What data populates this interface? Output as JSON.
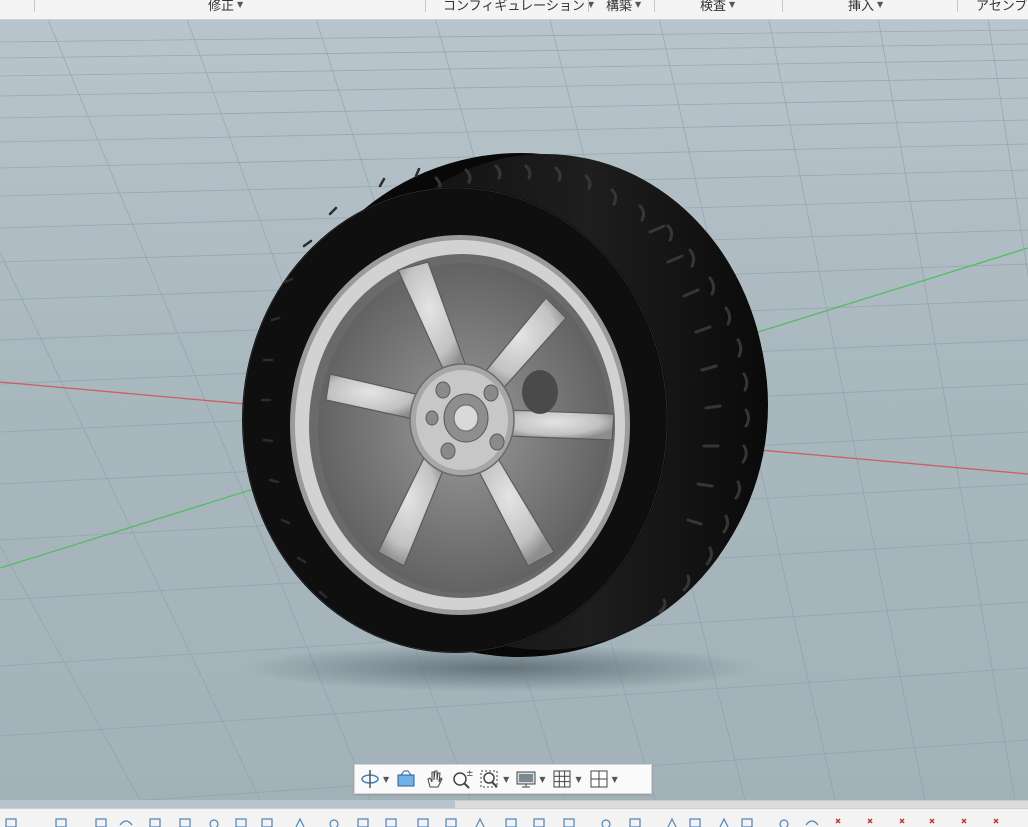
{
  "ribbon": {
    "tabs": [
      {
        "id": "modify",
        "label": "修正"
      },
      {
        "id": "configuration",
        "label": "コンフィギュレーション"
      },
      {
        "id": "construct",
        "label": "構築"
      },
      {
        "id": "inspect",
        "label": "検査"
      },
      {
        "id": "insert",
        "label": "挿入"
      },
      {
        "id": "assemble",
        "label": "アセンブリ"
      }
    ]
  },
  "viewport": {
    "model": "wheel-with-tire",
    "axes": {
      "x_color": "#d64a4a",
      "y_color": "#3fbf4a"
    },
    "colors": {
      "background_top": "#b9c5cc",
      "tire": "#141414",
      "rim": "#c9c9c9",
      "grid": "#8fa0a8"
    }
  },
  "view_toolbar": {
    "tools": [
      {
        "id": "orbit",
        "icon": "orbit-icon",
        "has_menu": true
      },
      {
        "id": "look-at",
        "icon": "look-at-icon",
        "has_menu": false
      },
      {
        "id": "pan",
        "icon": "pan-hand-icon",
        "has_menu": false
      },
      {
        "id": "zoom",
        "icon": "zoom-icon",
        "has_menu": false
      },
      {
        "id": "fit",
        "icon": "fit-window-icon",
        "has_menu": true
      },
      {
        "id": "display",
        "icon": "display-settings-icon",
        "has_menu": true
      },
      {
        "id": "grid",
        "icon": "grid-snap-icon",
        "has_menu": true
      },
      {
        "id": "viewports",
        "icon": "viewports-icon",
        "has_menu": true
      }
    ]
  }
}
